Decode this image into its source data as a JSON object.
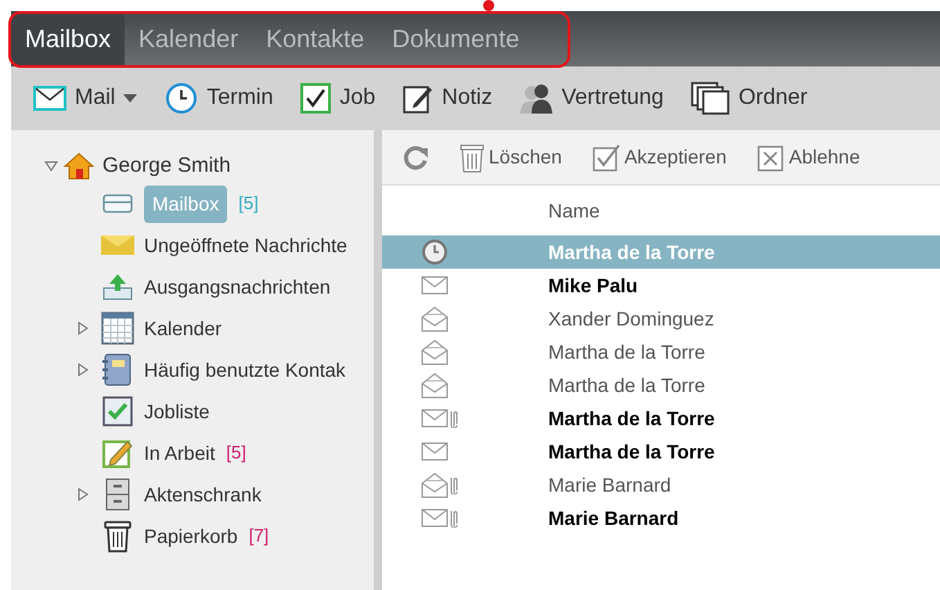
{
  "tabs": [
    {
      "label": "Mailbox",
      "selected": true
    },
    {
      "label": "Kalender",
      "selected": false
    },
    {
      "label": "Kontakte",
      "selected": false
    },
    {
      "label": "Dokumente",
      "selected": false
    }
  ],
  "toolbar": [
    {
      "kind": "mail",
      "label": "Mail",
      "dropdown": true
    },
    {
      "kind": "clock",
      "label": "Termin"
    },
    {
      "kind": "check",
      "label": "Job"
    },
    {
      "kind": "note",
      "label": "Notiz"
    },
    {
      "kind": "person",
      "label": "Vertretung"
    },
    {
      "kind": "folder",
      "label": "Ordner"
    }
  ],
  "tree": {
    "label": "George Smith",
    "expanded": true,
    "children": [
      {
        "kind": "inbox",
        "label": "Mailbox",
        "count": "[5]",
        "color": "#3aaabf",
        "selected": true
      },
      {
        "kind": "unread",
        "label": "Ungeöffnete Nachrichte",
        "selected": false
      },
      {
        "kind": "outbox",
        "label": "Ausgangsnachrichten",
        "selected": false
      },
      {
        "kind": "calendar",
        "label": "Kalender",
        "expandable": true,
        "selected": false
      },
      {
        "kind": "contacts",
        "label": "Häufig benutzte Kontak",
        "expandable": true,
        "selected": false
      },
      {
        "kind": "tasks",
        "label": "Jobliste",
        "selected": false
      },
      {
        "kind": "drafts",
        "label": "In Arbeit",
        "count": "[5]",
        "color": "#d0206e",
        "selected": false
      },
      {
        "kind": "cabinet",
        "label": "Aktenschrank",
        "expandable": true,
        "selected": false
      },
      {
        "kind": "trash",
        "label": "Papierkorb",
        "count": "[7]",
        "color": "#d0206e",
        "selected": false
      }
    ]
  },
  "actions": [
    {
      "kind": "refresh"
    },
    {
      "kind": "trash",
      "label": "Löschen"
    },
    {
      "kind": "accept",
      "label": "Akzeptieren"
    },
    {
      "kind": "decline",
      "label": "Ablehne"
    }
  ],
  "table": {
    "columns": [
      "Name"
    ],
    "rows": [
      {
        "kind": "appointment",
        "name": "Martha de la Torre",
        "unread": true,
        "attachment": false,
        "selected": true
      },
      {
        "kind": "mail",
        "name": "Mike Palu",
        "unread": true,
        "attachment": false,
        "selected": false
      },
      {
        "kind": "mail",
        "name": "Xander Dominguez",
        "unread": false,
        "attachment": false,
        "selected": false
      },
      {
        "kind": "mail",
        "name": "Martha de la Torre",
        "unread": false,
        "attachment": false,
        "selected": false
      },
      {
        "kind": "mail",
        "name": "Martha de la Torre",
        "unread": false,
        "attachment": false,
        "selected": false
      },
      {
        "kind": "mail",
        "name": "Martha de la Torre",
        "unread": true,
        "attachment": true,
        "selected": false
      },
      {
        "kind": "mail",
        "name": "Martha de la Torre",
        "unread": true,
        "attachment": false,
        "selected": false
      },
      {
        "kind": "mail",
        "name": "Marie Barnard",
        "unread": false,
        "attachment": true,
        "selected": false
      },
      {
        "kind": "mail",
        "name": "Marie Barnard",
        "unread": true,
        "attachment": true,
        "selected": false
      }
    ]
  }
}
